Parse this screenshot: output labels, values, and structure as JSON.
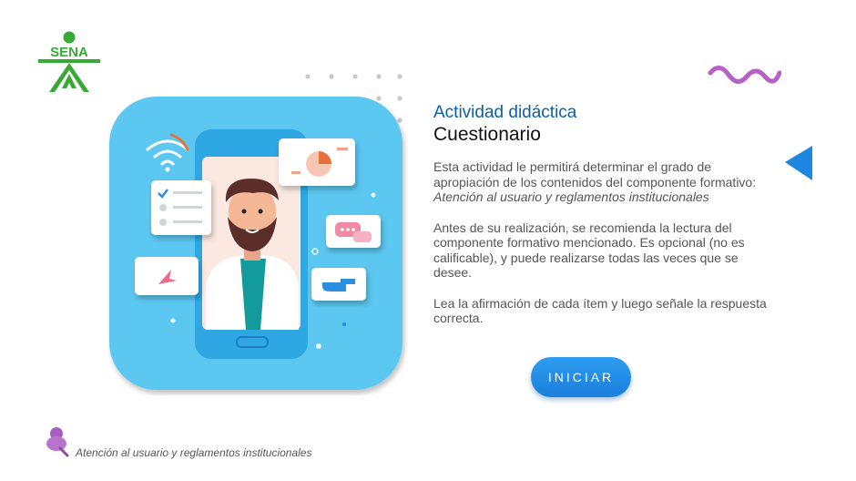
{
  "brand": {
    "logo_text": "SENA",
    "color": "#39a935"
  },
  "activity": {
    "kicker": "Actividad didáctica",
    "title": "Cuestionario",
    "intro_prefix": "Esta actividad le permitirá determinar el grado de apropiación de los contenidos del componente formativo: ",
    "intro_topic": "Atención al usuario y reglamentos institucionales",
    "para2": "Antes de su realización, se recomienda la lectura del componente formativo mencionado. Es opcional (no es calificable), y puede realizarse todas las veces que se desee.",
    "para3": "Lea la afirmación de cada ítem y luego señale la respuesta correcta.",
    "start_label": "INICIAR"
  },
  "footer": {
    "course": "Atención al usuario y reglamentos institucionales"
  },
  "icons": {
    "logo": "sena-logo",
    "prev": "back-arrow-icon",
    "pin": "pushpin-icon",
    "wave": "wave-decoration"
  },
  "colors": {
    "accent": "#0b5fa8",
    "button": "#1c7fdc",
    "illustration_bg": "#5cc7f0",
    "wave": "#b65fc6",
    "arrow": "#1d86e0"
  }
}
